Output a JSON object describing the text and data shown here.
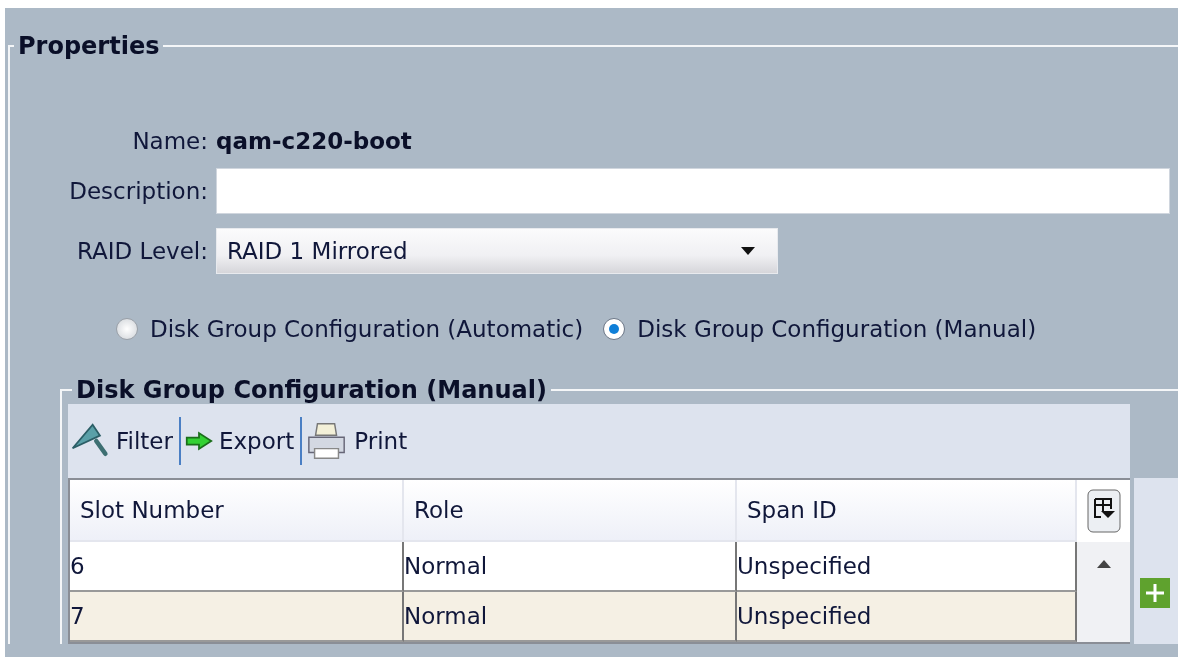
{
  "properties": {
    "title": "Properties",
    "name_label": "Name:",
    "name_value": "qam-c220-boot",
    "description_label": "Description:",
    "raid_label": "RAID Level:",
    "raid_value": "RAID 1 Mirrored"
  },
  "disk_group_options": [
    {
      "label": "Disk Group Configuration (Automatic)",
      "selected": false
    },
    {
      "label": "Disk Group Configuration (Manual)",
      "selected": true
    }
  ],
  "disk_group": {
    "title": "Disk Group Configuration (Manual)",
    "toolbar": [
      {
        "kind": "filter",
        "label": "Filter"
      },
      {
        "kind": "export",
        "label": "Export"
      },
      {
        "kind": "print",
        "label": "Print"
      }
    ],
    "table": {
      "columns": [
        "Slot Number",
        "Role",
        "Span ID"
      ],
      "rows": [
        [
          "6",
          "Normal",
          "Unspecified"
        ],
        [
          "7",
          "Normal",
          "Unspecified"
        ]
      ]
    }
  }
}
